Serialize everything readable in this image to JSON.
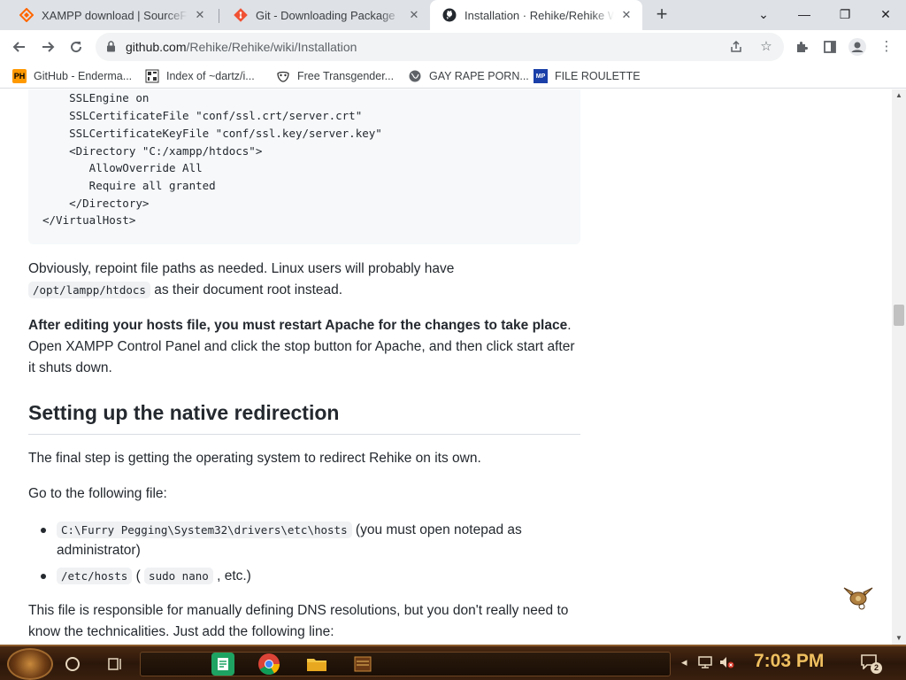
{
  "browser": {
    "tabs": [
      {
        "title": "XAMPP download | SourceForge.net",
        "icon": "sourceforge-icon",
        "active": false
      },
      {
        "title": "Git - Downloading Package",
        "icon": "git-icon",
        "active": false
      },
      {
        "title": "Installation · Rehike/Rehike Wiki",
        "icon": "github-icon",
        "active": true
      }
    ],
    "window_controls": {
      "menu": "⌄",
      "minimize": "—",
      "maximize": "❐",
      "close": "✕"
    },
    "new_tab": "+",
    "url_host": "github.com",
    "url_path": "/Rehike/Rehike/wiki/Installation",
    "bookmarks": [
      {
        "label": "GitHub - Enderma...",
        "icon": "ph-icon"
      },
      {
        "label": "Index of ~dartz/i...",
        "icon": "index-icon"
      },
      {
        "label": "Free Transgender...",
        "icon": "mask-icon"
      },
      {
        "label": "GAY RAPE PORN...",
        "icon": "globe-icon"
      },
      {
        "label": "FILE ROULETTE",
        "icon": "roulette-icon"
      }
    ]
  },
  "page": {
    "code_lines": [
      "    SSLEngine on",
      "    SSLCertificateFile \"conf/ssl.crt/server.crt\"",
      "    SSLCertificateKeyFile \"conf/ssl.key/server.key\"",
      "    <Directory \"C:/xampp/htdocs\">",
      "       AllowOverride All",
      "       Require all granted",
      "    </Directory>",
      "</VirtualHost>"
    ],
    "para1_text": "Obviously, repoint file paths as needed. Linux users will probably have",
    "para1_code": "/opt/lampp/htdocs",
    "para1_tail": " as their document root instead.",
    "para2_bold": "After editing your hosts file, you must restart Apache for the changes to take place",
    "para2_rest": ". Open XAMPP Control Panel and click the stop button for Apache, and then click start after it shuts down.",
    "heading": "Setting up the native redirection",
    "para3": "The final step is getting the operating system to redirect Rehike on its own.",
    "para4": "Go to the following file:",
    "list": [
      {
        "code": "C:\\Furry Pegging\\System32\\drivers\\etc\\hosts",
        "text": " (you must open notepad as administrator)"
      },
      {
        "code": "/etc/hosts",
        "mid": " ( ",
        "code2": "sudo nano",
        "text": " , etc.)"
      }
    ],
    "para5": "This file is responsible for manually defining DNS resolutions, but you don't really need to know the technicalities. Just add the following line:"
  },
  "taskbar": {
    "clock": "7:03 PM",
    "notification_count": "2",
    "search_icon": "cortana-icon",
    "task_view_icon": "task-view-icon"
  },
  "colors": {
    "accent": "#24292f",
    "code_bg": "#f6f8fa",
    "clock": "#f0c060"
  }
}
